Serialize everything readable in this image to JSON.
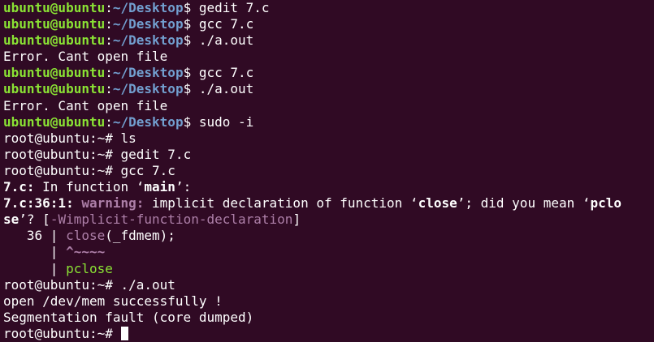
{
  "terminal": {
    "user_prompt_user": "ubuntu@ubuntu",
    "user_prompt_colon": ":",
    "user_prompt_path": "~/Desktop",
    "user_prompt_symbol": "$ ",
    "root_prompt": "root@ubuntu:~# ",
    "lines": {
      "l1_cmd": "gedit 7.c",
      "l2_cmd": "gcc 7.c",
      "l3_cmd": "./a.out",
      "l4_out": "Error. Cant open file",
      "l5_cmd": "gcc 7.c",
      "l6_cmd": "./a.out",
      "l7_out": "Error. Cant open file",
      "l8_cmd": "sudo -i",
      "l9_cmd": "ls",
      "l10_cmd": "gedit 7.c",
      "l11_cmd": "gcc 7.c",
      "l12_file": "7.c:",
      "l12_text": " In function ",
      "l12_q1": "‘",
      "l12_func": "main",
      "l12_q2": "’:",
      "l13_loc": "7.c:36:1:",
      "l13_sp": " ",
      "l13_warn": "warning:",
      "l13_text": " implicit declaration of function ",
      "l13_q1": "‘",
      "l13_func": "close",
      "l13_q2": "’",
      "l13_text2": "; did you mean ",
      "l13_q3": "‘",
      "l13_sugg": "pclo",
      "l14_sugg": "se",
      "l14_q": "’",
      "l14_text": "? [",
      "l14_flag": "-Wimplicit-function-declaration",
      "l14_end": "]",
      "l15_prefix": "   36 | ",
      "l15_fn": "close",
      "l15_rest": "(_fdmem);",
      "l16_prefix": "      | ",
      "l16_caret": "^~~~~",
      "l17_prefix": "      | ",
      "l17_fix": "pclose",
      "l18_cmd": "./a.out",
      "l19_out": "open /dev/mem successfully !",
      "l20_out": "Segmentation fault (core dumped)"
    }
  },
  "colors": {
    "background": "#300a24",
    "text": "#ffffff",
    "prompt_user": "#8ae234",
    "prompt_path": "#729fcf",
    "warning": "#ad7fa8"
  }
}
